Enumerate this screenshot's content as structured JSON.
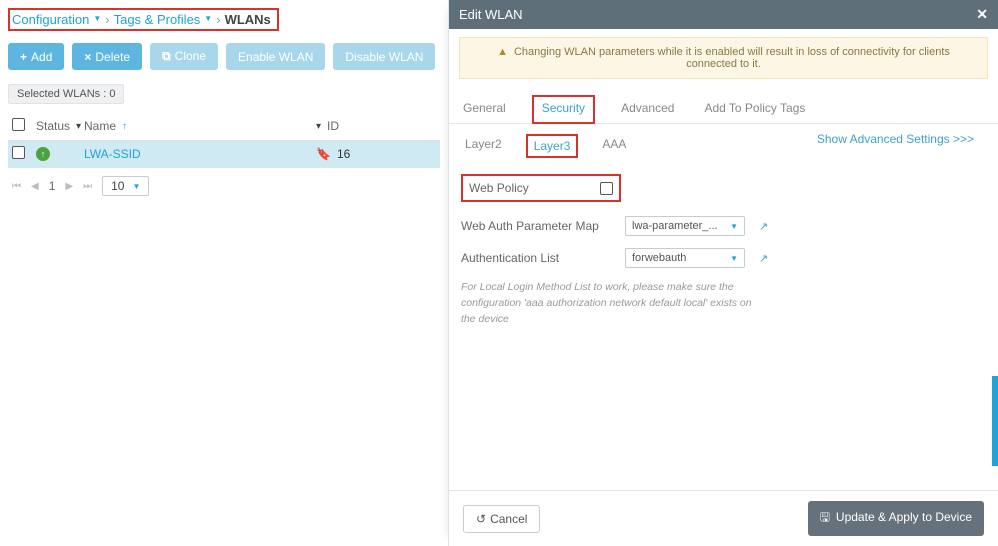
{
  "breadcrumb": {
    "a": "Configuration",
    "b": "Tags & Profiles",
    "current": "WLANs"
  },
  "buttons": {
    "add": "Add",
    "delete": "Delete",
    "clone": "Clone",
    "enable": "Enable WLAN",
    "disable": "Disable WLAN"
  },
  "selected_label": "Selected WLANs : 0",
  "columns": {
    "status": "Status",
    "name": "Name",
    "id": "ID"
  },
  "rows": [
    {
      "name": "LWA-SSID",
      "id": "16"
    }
  ],
  "pager": {
    "page": "1",
    "pagesize": "10"
  },
  "panel": {
    "title": "Edit WLAN",
    "alert": "Changing WLAN parameters while it is enabled will result in loss of connectivity for clients connected to it.",
    "tabs1": {
      "general": "General",
      "security": "Security",
      "advanced": "Advanced",
      "addpolicy": "Add To Policy Tags"
    },
    "tabs2": {
      "l2": "Layer2",
      "l3": "Layer3",
      "aaa": "AAA"
    },
    "adv_link": "Show Advanced Settings >>>",
    "webpolicy": "Web Policy",
    "fields": {
      "param_label": "Web Auth Parameter Map",
      "param_value": "lwa-parameter_...",
      "auth_label": "Authentication List",
      "auth_value": "forwebauth"
    },
    "note": "For Local Login Method List to work, please make sure the configuration 'aaa authorization network default local' exists on the device",
    "cancel": "Cancel",
    "apply": "Update & Apply to Device"
  }
}
